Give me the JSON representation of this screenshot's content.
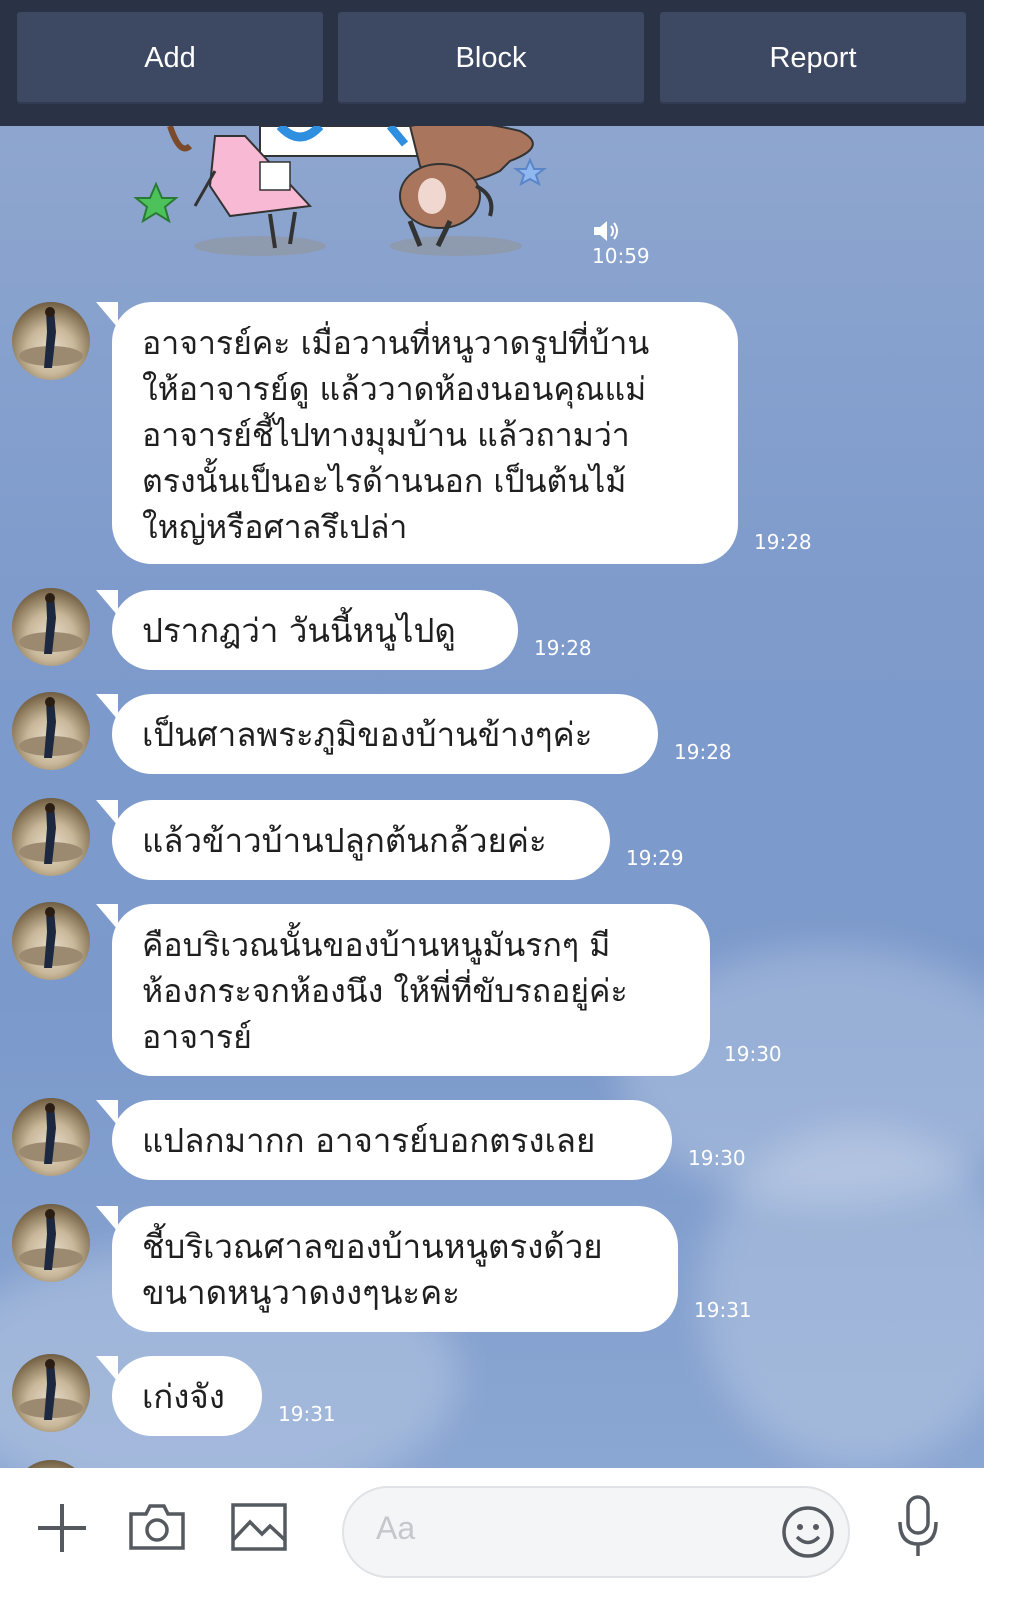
{
  "header": {
    "buttons": [
      {
        "label": "Add"
      },
      {
        "label": "Block"
      },
      {
        "label": "Report"
      }
    ]
  },
  "sticker": {
    "time": "10:59",
    "icon": "speaker-icon"
  },
  "messages": [
    {
      "text": "อาจารย์คะ เมื่อวานที่หนูวาดรูปที่บ้าน\nให้อาจารย์ดู แล้ววาดห้องนอนคุณแม่\nอาจารย์ชี้ไปทางมุมบ้าน แล้วถามว่า\nตรงนั้นเป็นอะไรด้านนอก เป็นต้นไม้\nใหญ่หรือศาลรึเปล่า",
      "time": "19:28"
    },
    {
      "text": "ปรากฎว่า วันนี้หนูไปดู",
      "time": "19:28"
    },
    {
      "text": "เป็นศาลพระภูมิของบ้านข้างๆค่ะ",
      "time": "19:28"
    },
    {
      "text": "แล้วข้าวบ้านปลูกต้นกล้วยค่ะ",
      "time": "19:29"
    },
    {
      "text": "คือบริเวณนั้นของบ้านหนูมันรกๆ มี\nห้องกระจกห้องนึง ให้พี่ที่ขับรถอยู่ค่ะ\nอาจารย์",
      "time": "19:30"
    },
    {
      "text": "แปลกมากก อาจารย์บอกตรงเลย",
      "time": "19:30"
    },
    {
      "text": "ชี้บริเวณศาลของบ้านหนูตรงด้วย\nขนาดหนูวาดงงๆนะคะ",
      "time": "19:31"
    },
    {
      "text": "เก่งจัง",
      "time": "19:31"
    }
  ],
  "composer": {
    "placeholder": "Aa",
    "icons": [
      "plus-icon",
      "camera-icon",
      "image-icon",
      "emoji-icon",
      "microphone-icon"
    ]
  },
  "colors": {
    "header_bg": "#2a3346",
    "header_button": "#3d4963",
    "chat_bg": "#7e9bcc",
    "bubble": "#ffffff"
  }
}
